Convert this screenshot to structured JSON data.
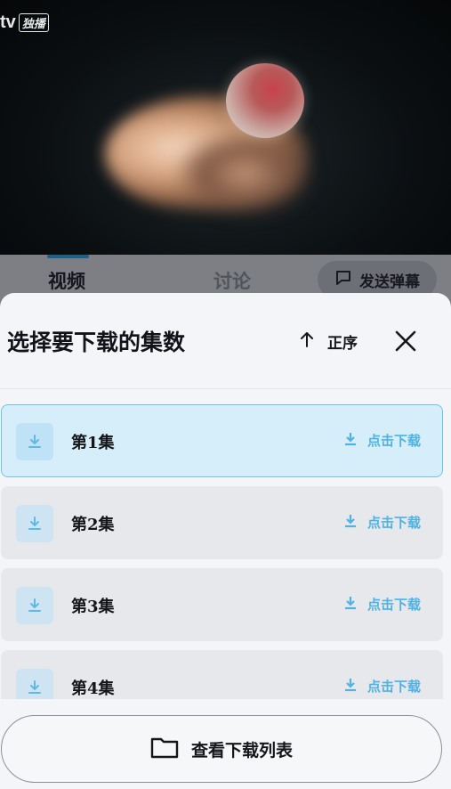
{
  "video": {
    "watermark_text": "tv",
    "watermark_tag": "独播"
  },
  "tabs": {
    "video_label": "视频",
    "discuss_label": "讨论",
    "danmu_label": "发送弹幕"
  },
  "sheet": {
    "title": "选择要下载的集数",
    "order_label": "正序",
    "episodes": [
      {
        "label": "第1集",
        "action": "点击下载",
        "active": true
      },
      {
        "label": "第2集",
        "action": "点击下载",
        "active": false
      },
      {
        "label": "第3集",
        "action": "点击下载",
        "active": false
      },
      {
        "label": "第4集",
        "action": "点击下载",
        "active": false
      }
    ],
    "footer_label": "查看下载列表"
  },
  "colors": {
    "accent": "#4fb2e4",
    "active_bg": "#d6eefa",
    "active_border": "#6cc3ee"
  },
  "icons": [
    "chat-bubble-icon",
    "arrow-up-icon",
    "close-icon",
    "download-icon",
    "folder-icon"
  ]
}
